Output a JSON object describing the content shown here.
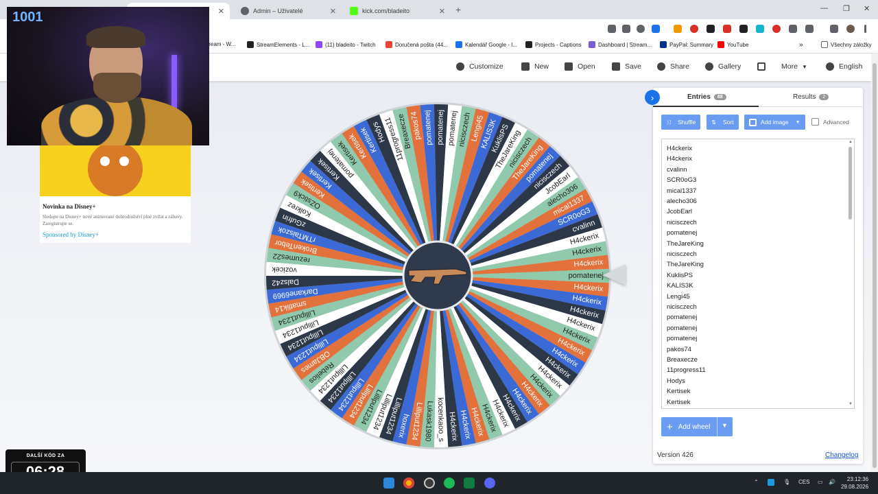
{
  "browser": {
    "tabs": [
      {
        "label": "",
        "active": true
      },
      {
        "label": "Admin – Uživatelé",
        "active": false
      },
      {
        "label": "kick.com/bladeito",
        "active": false
      }
    ],
    "bookmarks": [
      "tream - W...",
      "StreamElements - L...",
      "(11) bladeito - Twitch",
      "Doručená pošta (44...",
      "Kalendář Google - I...",
      "Projects - Captions",
      "Dashboard | Stream...",
      "PayPal: Summary",
      "YouTube",
      "Všechny záložky"
    ]
  },
  "appbar": {
    "customize": "Customize",
    "new": "New",
    "open": "Open",
    "save": "Save",
    "share": "Share",
    "gallery": "Gallery",
    "more": "More",
    "language": "English"
  },
  "ad": {
    "title": "Novinka na Disney+",
    "description": "Sledujte na Disney+ nové animované dobrodružství plné zvířat a zábavy. Zaregistrujte se.",
    "sponsor": "Sponsored by Disney+"
  },
  "webcam": {
    "counter": "1001"
  },
  "panel": {
    "entries_tab": "Entries",
    "entries_count": "88",
    "results_tab": "Results",
    "results_count": "2",
    "shuffle": "Shuffle",
    "sort": "Sort",
    "add_image": "Add image",
    "advanced": "Advanced",
    "add_wheel": "Add wheel",
    "version": "Version 426",
    "changelog": "Changelog",
    "entries": [
      "H4ckerix",
      "H4ckerix",
      "cvalinn",
      "SCR0oG3",
      "mical1337",
      "alecho306",
      "JcobEarl",
      "nicisczech",
      "pomatenej",
      "TheJareKing",
      "nicisczech",
      "TheJareKing",
      "KuklisPS",
      "KALIS3K",
      "Lengi45",
      "nicisczech",
      "pomatenej",
      "pomatenej",
      "pomatenej",
      "pakos74",
      "Breaxecze",
      "11progress11",
      "Hodys",
      "Kertisek",
      "Kertisek"
    ]
  },
  "wheel": {
    "colors": [
      "#90c9ab",
      "#e2713b",
      "#3b6ad6",
      "#2c3748",
      "#ffffff"
    ],
    "segments": [
      "pomatenej",
      "H4ckerix",
      "H4ckerix",
      "H4ckerix",
      "H4ckerix",
      "H4ckerix",
      "H4ckerix",
      "H4ckerix",
      "H4ckerix",
      "H4ckerix",
      "H4ckerix",
      "H4ckerix",
      "H4ckerix",
      "H4ckerix",
      "H4ckerix",
      "H4ckerix",
      "H4ckerix",
      "H4ckerix",
      "H4ckerix",
      "kocenkaoo_s",
      "Lukask1980",
      "Lilliput1234",
      "hoxerix",
      "Lilliput1234",
      "Lilliput1234",
      "Lilliput1234",
      "Lilliput1234",
      "Lilliput1234",
      "Lilliput1234",
      "Lilliput1234",
      "Rebelios",
      "OBJames",
      "Lilliput1234",
      "Lilliput1234",
      "Lilliput1234",
      "Lilliput1234",
      "smatlik14",
      "Darkane6969",
      "Dalsz42",
      "vozicek",
      "rezumes22",
      "BrokenTebor",
      "rTMTaiszok",
      "zGufrin",
      "Kolkrez",
      "OZstick9",
      "Kertisek",
      "Kertisek",
      "Kertisek",
      "pomatenej",
      "Kertisek",
      "Kertisek",
      "Kertisek",
      "Hodys",
      "11progress11",
      "Breaxecze",
      "pakos74",
      "pomatenej",
      "pomatenej",
      "pomatenej",
      "nicisczech",
      "Lengi45",
      "KALIS3K",
      "KuklisPS",
      "TheJareKing",
      "nicisczech",
      "TheJareKing",
      "pomatenej",
      "nicisczech",
      "JcobEarl",
      "alecho306",
      "mical1337",
      "SCR0oG3",
      "cvalinn",
      "H4ckerix",
      "H4ckerix",
      "H4ckerix"
    ]
  },
  "timer": {
    "label": "DALŠÍ KÓD ZA",
    "value": "06:28"
  },
  "taskbar": {
    "lang": "CES",
    "time": "23:12:36",
    "date": "29.08.2026"
  }
}
